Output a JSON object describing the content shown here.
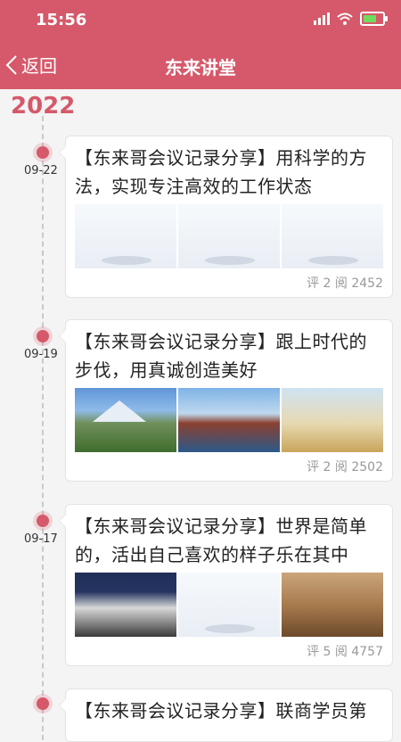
{
  "status": {
    "time": "15:56"
  },
  "nav": {
    "back_label": "返回",
    "title": "东来讲堂"
  },
  "year": "2022",
  "entries": [
    {
      "date": "09-22",
      "title_line1": "【东来哥会议记录分享】用科学的方",
      "title_line2": "法，实现专注高效的工作状态",
      "stats": "评 2 阅 2452"
    },
    {
      "date": "09-19",
      "title_line1": "【东来哥会议记录分享】跟上时代的",
      "title_line2": "步伐，用真诚创造美好",
      "stats": "评 2 阅 2502"
    },
    {
      "date": "09-17",
      "title_line1": "【东来哥会议记录分享】世界是简单",
      "title_line2": "的，活出自己喜欢的样子乐在其中",
      "stats": "评 5 阅 4757"
    },
    {
      "title_line1": "【东来哥会议记录分享】联商学员第"
    }
  ],
  "colors": {
    "accent": "#d5596a",
    "battery": "#6ddc5c"
  }
}
